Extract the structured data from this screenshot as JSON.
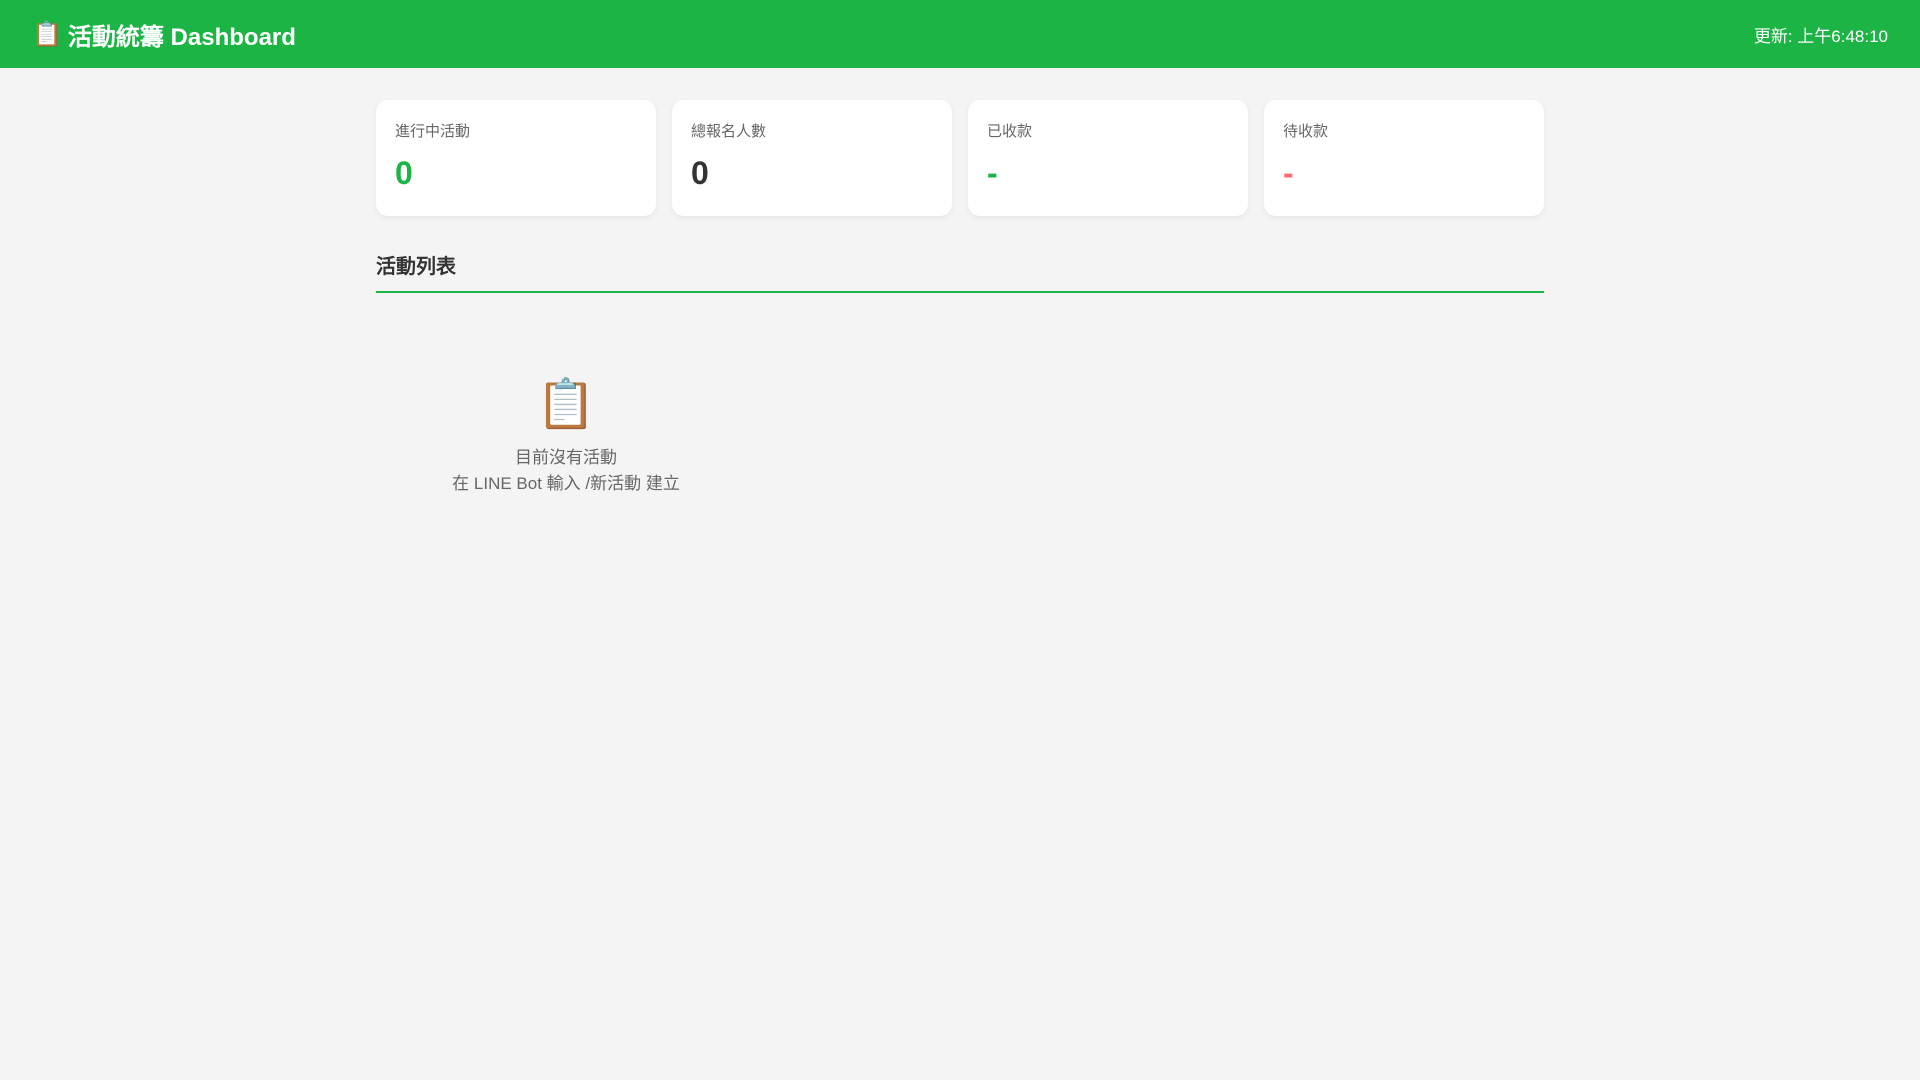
{
  "header": {
    "icon": "clipboard-icon",
    "title": "活動統籌 Dashboard",
    "updated": "更新: 上午6:48:10"
  },
  "colors": {
    "brand": "#1db446",
    "positive": "#1db446",
    "pending": "#ff6b6b"
  },
  "stats": [
    {
      "label": "進行中活動",
      "value": "0"
    },
    {
      "label": "總報名人數",
      "value": "0"
    },
    {
      "label": "已收款",
      "value": "-"
    },
    {
      "label": "待收款",
      "value": "-"
    }
  ],
  "list": {
    "title": "活動列表",
    "empty_icon": "clipboard-icon",
    "empty_title": "目前沒有活動",
    "empty_hint": "在 LINE Bot 輸入 /新活動 建立"
  }
}
